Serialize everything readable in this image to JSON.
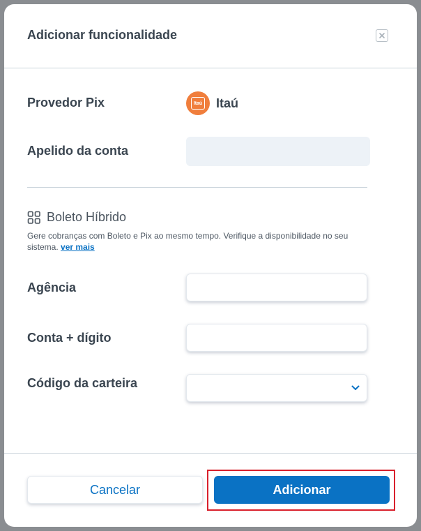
{
  "modal": {
    "title": "Adicionar funcionalidade"
  },
  "form": {
    "pix_provider_label": "Provedor Pix",
    "pix_provider_name": "Itaú",
    "bank_logo_text": "Itaú",
    "account_nickname_label": "Apelido da conta",
    "account_nickname_value": ""
  },
  "boleto_section": {
    "title": "Boleto Híbrido",
    "description": "Gere cobranças com Boleto e Pix ao mesmo tempo. Verifique a disponibilidade no seu sistema.",
    "link_text": "ver mais",
    "agency_label": "Agência",
    "agency_value": "",
    "account_label": "Conta + dígito",
    "account_value": "",
    "wallet_code_label": "Código da carteira",
    "wallet_code_value": ""
  },
  "footer": {
    "cancel_label": "Cancelar",
    "add_label": "Adicionar"
  },
  "colors": {
    "accent": "#0a72c4",
    "bank_orange": "#f07e3c",
    "highlight": "#d9202c"
  }
}
